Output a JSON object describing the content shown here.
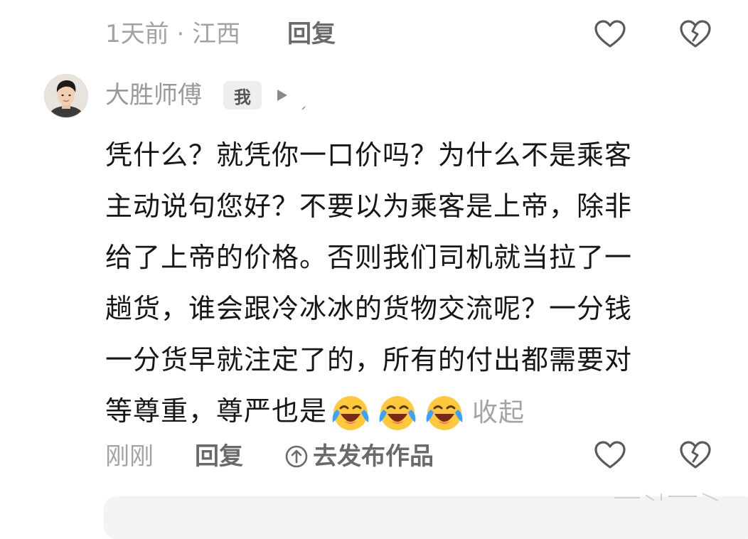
{
  "previous_comment": {
    "time_location": "1天前 · 江西",
    "reply_label": "回复"
  },
  "comment": {
    "author": "大胜师傅",
    "author_badge": "我",
    "lines": [
      "凭什么？就凭你一口价吗？为什么不是乘客",
      "主动说句您好？不要以为乘客是上帝，除非",
      "给了上帝的价格。否则我们司机就当拉了一",
      "趟货，谁会跟冷冰冰的货物交流呢？一分钱",
      "一分货早就注定了的，所有的付出都需要对",
      "等尊重，尊严也是"
    ],
    "emojis": [
      "laughing-crying-emoji",
      "laughing-crying-emoji",
      "laughing-crying-emoji"
    ],
    "collapse_label": "收起",
    "time": "刚刚",
    "reply_label": "回复",
    "publish_label": "去发布作品"
  },
  "colors": {
    "meta_gray": "#a3a3a3",
    "action_gray": "#6a6a6a",
    "text": "#161616",
    "emoji_yellow": "#ffc83d",
    "emoji_tears": "#3aa3ff"
  },
  "icons": [
    "heart-outline-icon",
    "broken-heart-icon",
    "play-triangle-icon",
    "upload-circle-icon"
  ]
}
